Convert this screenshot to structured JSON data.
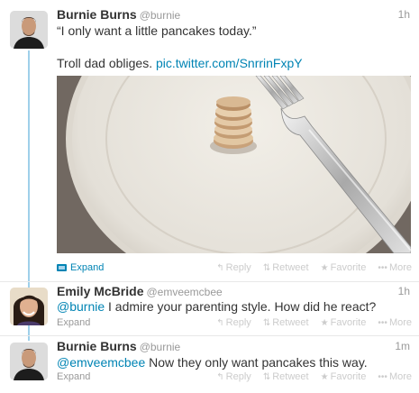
{
  "tweets": [
    {
      "fullname": "Burnie Burns",
      "username": "@burnie",
      "time": "1h",
      "text_line1": "“I only want a little pancakes today.”",
      "text_line2": "Troll dad obliges.",
      "link": "pic.twitter.com/SnrrinFxpY",
      "expand": "Expand"
    },
    {
      "fullname": "Emily McBride",
      "username": "@emveemcbee",
      "time": "1h",
      "mention": "@burnie",
      "text": " I admire your parenting style. How did he react?",
      "expand": "Expand"
    },
    {
      "fullname": "Burnie Burns",
      "username": "@burnie",
      "time": "1m",
      "mention": "@emveemcbee",
      "text": " Now they only want pancakes this way.",
      "expand": "Expand"
    }
  ],
  "actions": {
    "reply": "Reply",
    "retweet": "Retweet",
    "favorite": "Favorite",
    "more": "More"
  },
  "colors": {
    "link": "#0084b4",
    "thread_line": "#9fd0ea",
    "muted": "#999999",
    "action_gray": "#cccccc"
  }
}
